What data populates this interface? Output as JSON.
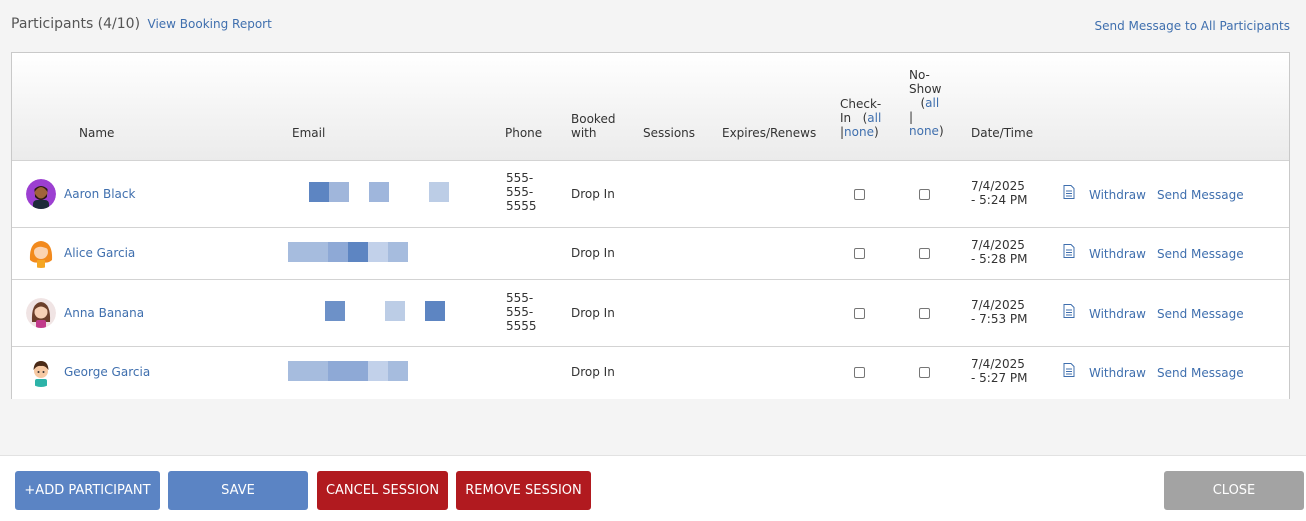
{
  "header": {
    "participants_label": "Participants (4/10)",
    "view_report_link": "View Booking Report",
    "send_all_link": "Send Message to All Participants"
  },
  "table": {
    "columns": {
      "name": "Name",
      "email": "Email",
      "phone": "Phone",
      "booked_with_1": "Booked",
      "booked_with_2": "with",
      "sessions": "Sessions",
      "expires": "Expires/Renews",
      "checkin_1": "Check-",
      "checkin_2": "In",
      "noshow_1": "No-",
      "noshow_2": "Show",
      "all": "all",
      "sep": "|",
      "none": "none",
      "datetime": "Date/Time"
    },
    "rows": [
      {
        "name": "Aaron Black",
        "avatar": "man-avatar-icon",
        "phone": [
          "555-",
          "555-",
          "5555"
        ],
        "booked_with": "Drop In",
        "date": [
          "7/4/2025",
          "- 5:24 PM"
        ],
        "withdraw": "Withdraw",
        "send_message": "Send Message"
      },
      {
        "name": "Alice Garcia",
        "avatar": "woman-orange-avatar-icon",
        "phone": [],
        "booked_with": "Drop In",
        "date": [
          "7/4/2025",
          "- 5:28 PM"
        ],
        "withdraw": "Withdraw",
        "send_message": "Send Message"
      },
      {
        "name": "Anna Banana",
        "avatar": "woman-brown-avatar-icon",
        "phone": [
          "555-",
          "555-",
          "5555"
        ],
        "booked_with": "Drop In",
        "date": [
          "7/4/2025",
          "- 7:53 PM"
        ],
        "withdraw": "Withdraw",
        "send_message": "Send Message"
      },
      {
        "name": "George Garcia",
        "avatar": "boy-avatar-icon",
        "phone": [],
        "booked_with": "Drop In",
        "date": [
          "7/4/2025",
          "- 5:27 PM"
        ],
        "withdraw": "Withdraw",
        "send_message": "Send Message"
      }
    ]
  },
  "footer": {
    "add_participant": "+ADD PARTICIPANT",
    "save": "SAVE",
    "cancel_session": "CANCEL SESSION",
    "remove_session": "REMOVE SESSION",
    "close": "CLOSE"
  },
  "colors": {
    "link": "#3f6fae",
    "primary_button": "#5b84c4",
    "danger_button": "#b11a1f",
    "close_button": "#a3a3a3"
  }
}
